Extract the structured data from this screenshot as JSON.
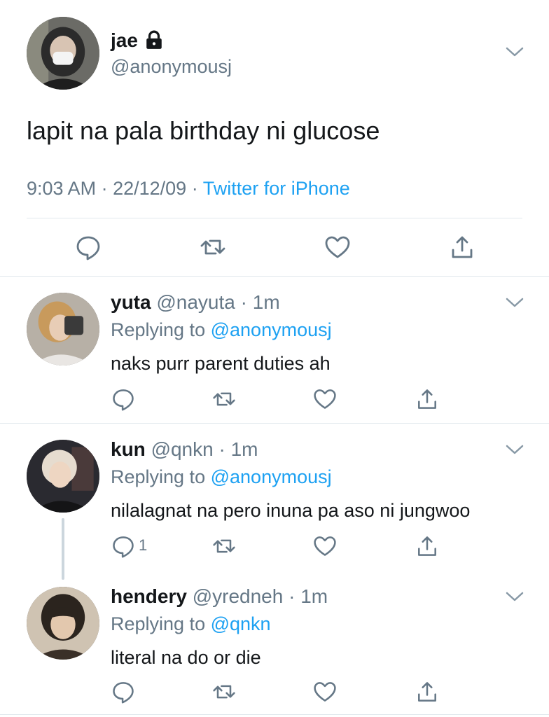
{
  "main_tweet": {
    "author_name": "jae",
    "author_handle": "@anonymousj",
    "text": "lapit na pala birthday ni glucose",
    "time": "9:03 AM",
    "dot": "·",
    "date": "22/12/09",
    "source": "Twitter for iPhone"
  },
  "replies": [
    {
      "name": "yuta",
      "handle": "@nayuta",
      "sep": "·",
      "time": "1m",
      "replying_label": "Replying to",
      "replying_to": "@anonymousj",
      "text": "naks purr parent duties ah",
      "reply_count": ""
    },
    {
      "name": "kun",
      "handle": "@qnkn",
      "sep": "·",
      "time": "1m",
      "replying_label": "Replying to",
      "replying_to": "@anonymousj",
      "text": "nilalagnat na pero inuna pa aso ni jungwoo",
      "reply_count": "1"
    },
    {
      "name": "hendery",
      "handle": "@yredneh",
      "sep": "·",
      "time": "1m",
      "replying_label": "Replying to",
      "replying_to": "@qnkn",
      "text": "literal na do or die",
      "reply_count": ""
    }
  ],
  "icons": {
    "lock": "lock-icon",
    "chevron": "chevron-down-icon",
    "reply": "reply-icon",
    "retweet": "retweet-icon",
    "like": "heart-icon",
    "share": "share-icon"
  },
  "colors": {
    "text": "#14171a",
    "secondary": "#657786",
    "link": "#1da1f2",
    "divider": "#e1e8ed",
    "thread_line": "#ccd6dd"
  }
}
